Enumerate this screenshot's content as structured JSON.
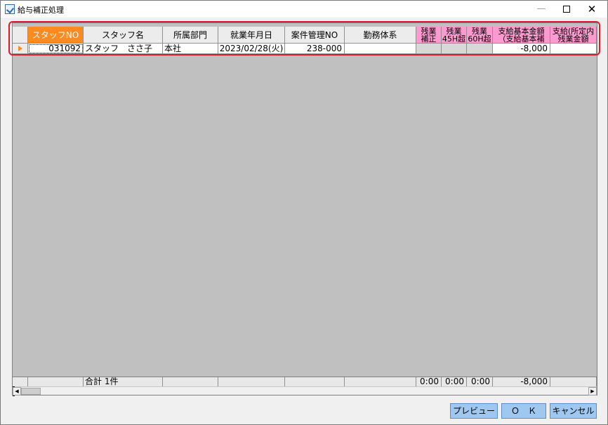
{
  "window": {
    "title": "給与補正処理",
    "minimize_glyph": "—",
    "close_glyph": "✕"
  },
  "grid": {
    "columns": [
      {
        "label": "スタッフNO"
      },
      {
        "label": "スタッフ名"
      },
      {
        "label": "所属部門"
      },
      {
        "label": "就業年月日"
      },
      {
        "label": "案件管理NO"
      },
      {
        "label": "勤務体系"
      },
      {
        "label": "残業補正"
      },
      {
        "label": "残業45H超"
      },
      {
        "label": "残業60H超"
      },
      {
        "label": "支給基本金額（支給基本補"
      },
      {
        "label": "支給(所定内残業金額"
      }
    ],
    "header_lines": {
      "overtime_adj": [
        "残業",
        "補正"
      ],
      "overtime_45": [
        "残業",
        "45H超"
      ],
      "overtime_60": [
        "残業",
        "60H超"
      ],
      "base_amount": [
        "支給基本金額",
        "（支給基本補"
      ],
      "scheduled": [
        "支給(所定内",
        "残業金額"
      ]
    },
    "rows": [
      {
        "staff_no": "031092",
        "staff_name": "スタッフ　ささ子",
        "department": "本社",
        "work_date": "2023/02/28(火)",
        "project_no": "238-000",
        "work_system": "",
        "overtime_adj": "",
        "overtime_45": "",
        "overtime_60": "",
        "base_amount": "-8,000",
        "scheduled": ""
      }
    ],
    "totals": {
      "label": "合計 1件",
      "overtime_adj": "0:00",
      "overtime_45": "0:00",
      "overtime_60": "0:00",
      "base_amount": "-8,000"
    },
    "scroll": {
      "left_glyph": "◀",
      "right_glyph": "▶"
    }
  },
  "buttons": {
    "preview": "プレビュー",
    "ok": "Ｏ　Ｋ",
    "cancel": "キャンセル"
  },
  "colors": {
    "key_column_header": "#ff8a1f",
    "amount_column_header": "#ff9ad0",
    "highlight_border": "#e0192b",
    "button_bg": "#9ec8f0",
    "grid_bg": "#c0c0c0"
  }
}
